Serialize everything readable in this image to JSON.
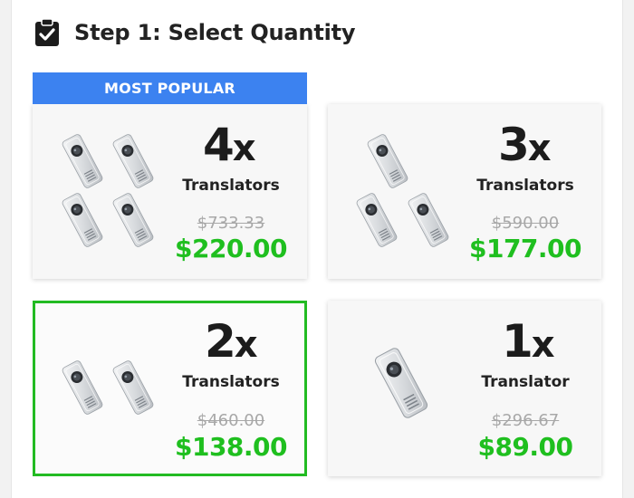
{
  "header": {
    "title": "Step 1: Select Quantity",
    "icon": "clipboard-check-icon"
  },
  "badge": {
    "label": "MOST POPULAR"
  },
  "colors": {
    "badge_blue": "#3c82f0",
    "price_green": "#1fbf1f",
    "selected_border": "#22bb22"
  },
  "options": [
    {
      "qty_num": "4",
      "qty_x": "x",
      "unit": "Translators",
      "old_price": "$733.33",
      "new_price": "$220.00",
      "devices": 4,
      "most_popular": true,
      "selected": false
    },
    {
      "qty_num": "3",
      "qty_x": "x",
      "unit": "Translators",
      "old_price": "$590.00",
      "new_price": "$177.00",
      "devices": 3,
      "most_popular": false,
      "selected": false
    },
    {
      "qty_num": "2",
      "qty_x": "x",
      "unit": "Translators",
      "old_price": "$460.00",
      "new_price": "$138.00",
      "devices": 2,
      "most_popular": false,
      "selected": true
    },
    {
      "qty_num": "1",
      "qty_x": "x",
      "unit": "Translator",
      "old_price": "$296.67",
      "new_price": "$89.00",
      "devices": 1,
      "most_popular": false,
      "selected": false
    }
  ]
}
